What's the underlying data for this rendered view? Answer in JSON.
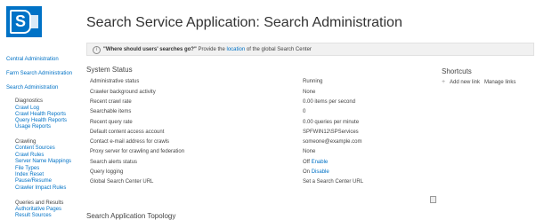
{
  "header": {
    "logo_letter": "S",
    "title": "Search Service Application: Search Administration"
  },
  "notice": {
    "icon": "info-icon",
    "question": "\"Where should users' searches go?\"",
    "prefix": "Provide the",
    "link": "location",
    "suffix": "of the global Search Center"
  },
  "nav": {
    "top_links": [
      "Central Administration",
      "Farm Search Administration",
      "Search Administration"
    ],
    "groups": [
      {
        "heading": "Diagnostics",
        "items": [
          "Crawl Log",
          "Crawl Health Reports",
          "Query Health Reports",
          "Usage Reports"
        ]
      },
      {
        "heading": "Crawling",
        "items": [
          "Content Sources",
          "Crawl Rules",
          "Server Name Mappings",
          "File Types",
          "Index Reset",
          "Pause/Resume",
          "Crawler Impact Rules"
        ]
      },
      {
        "heading": "Queries and Results",
        "items": [
          "Authoritative Pages",
          "Result Sources"
        ]
      }
    ]
  },
  "system_status": {
    "heading": "System Status",
    "rows": [
      {
        "label": "Administrative status",
        "value": "Running",
        "link": ""
      },
      {
        "label": "Crawler background activity",
        "value": "None",
        "link": ""
      },
      {
        "label": "Recent crawl rate",
        "value": "0.00 items per second",
        "link": ""
      },
      {
        "label": "Searchable items",
        "value": "0",
        "link": ""
      },
      {
        "label": "Recent query rate",
        "value": "0.00 queries per minute",
        "link": ""
      },
      {
        "label": "Default content access account",
        "value": "",
        "link": "SPFWIN12\\SPServices"
      },
      {
        "label": "Contact e-mail address for crawls",
        "value": "",
        "link": "someone@example.com"
      },
      {
        "label": "Proxy server for crawling and federation",
        "value": "",
        "link": "None"
      },
      {
        "label": "Search alerts status",
        "value": "Off",
        "link": "Enable"
      },
      {
        "label": "Query logging",
        "value": "On",
        "link": "Disable"
      },
      {
        "label": "Global Search Center URL",
        "value": "",
        "link": "Set a Search Center URL"
      }
    ]
  },
  "shortcuts": {
    "heading": "Shortcuts",
    "add_new_link": "Add new link",
    "manage_links": "Manage links"
  },
  "topology": {
    "heading": "Search Application Topology"
  }
}
